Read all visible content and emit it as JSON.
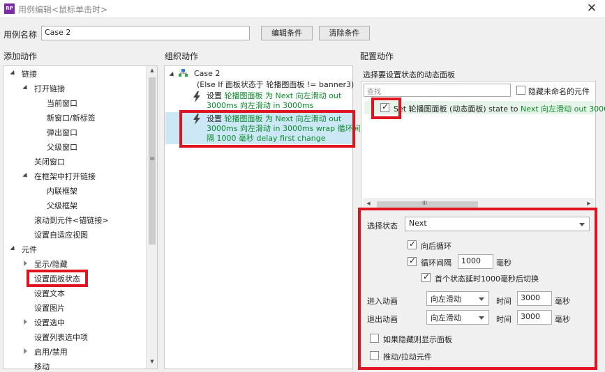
{
  "window": {
    "title": "用例编辑<鼠标单击时>",
    "app_icon": "RP",
    "close": "✕"
  },
  "case_name": {
    "label": "用例名称",
    "value": "Case 2",
    "edit_button": "编辑条件",
    "clear_button": "清除条件"
  },
  "add_actions": {
    "header": "添加动作",
    "items": [
      {
        "label": "链接",
        "kind": "open"
      },
      {
        "label": "打开链接",
        "kind": "open"
      },
      {
        "label": "当前窗口",
        "kind": "leaf"
      },
      {
        "label": "新窗口/新标签",
        "kind": "leaf"
      },
      {
        "label": "弹出窗口",
        "kind": "leaf"
      },
      {
        "label": "父级窗口",
        "kind": "leaf"
      },
      {
        "label": "关闭窗口",
        "kind": "leaf"
      },
      {
        "label": "在框架中打开链接",
        "kind": "open"
      },
      {
        "label": "内联框架",
        "kind": "leaf"
      },
      {
        "label": "父级框架",
        "kind": "leaf"
      },
      {
        "label": "滚动到元件<锚链接>",
        "kind": "leaf"
      },
      {
        "label": "设置自适应视图",
        "kind": "leaf"
      },
      {
        "label": "元件",
        "kind": "open"
      },
      {
        "label": "显示/隐藏",
        "kind": "closed"
      },
      {
        "label": "设置面板状态",
        "kind": "leaf"
      },
      {
        "label": "设置文本",
        "kind": "leaf"
      },
      {
        "label": "设置图片",
        "kind": "leaf"
      },
      {
        "label": "设置选中",
        "kind": "closed"
      },
      {
        "label": "设置列表选中项",
        "kind": "leaf"
      },
      {
        "label": "启用/禁用",
        "kind": "closed"
      },
      {
        "label": "移动",
        "kind": "leaf"
      }
    ],
    "scroll_mark": "≡"
  },
  "organize": {
    "header": "组织动作",
    "case_title": "Case 2",
    "condition": "(Else If 面板状态于 轮播图面板 != banner3)",
    "action1": {
      "prefix": "设置 ",
      "lines": [
        "轮播图面板 为 Next 向左滑动 out",
        "3000ms 向左滑动 in 3000ms"
      ]
    },
    "action2": {
      "prefix": "设置 ",
      "lines": [
        "轮播图面板 为 Next 向左滑动 out",
        "3000ms 向左滑动 in 3000ms wrap 循环间",
        "隔 1000 毫秒 delay first change"
      ]
    }
  },
  "configure": {
    "header": "配置动作",
    "subheader": "选择要设置状态的动态面板",
    "search_placeholder": "查找",
    "hide_unnamed": "隐藏未命名的元件",
    "row_prefix": "Set 轮播图面板 (动态面板) state to ",
    "row_green": "Next 向左滑动 out 3000",
    "hscroll_mark": "III",
    "select_state_label": "选择状态",
    "select_state_value": "Next",
    "wrap_label": "向后循环",
    "interval_label": "循环间隔",
    "interval_value": "1000",
    "interval_unit": "毫秒",
    "first_delay_label": "首个状态延时1000毫秒后切换",
    "enter_label": "进入动画",
    "enter_value": "向左滑动",
    "enter_time_label": "时间",
    "enter_time_value": "3000",
    "enter_time_unit": "毫秒",
    "exit_label": "退出动画",
    "exit_value": "向左滑动",
    "exit_time_label": "时间",
    "exit_time_value": "3000",
    "exit_time_unit": "毫秒",
    "show_if_hidden": "如果隐藏则显示面板",
    "push_pull": "推动/拉动元件"
  },
  "colors": {
    "highlight": "#e0141e",
    "action_text": "#0b8a2a",
    "selected_row": "#cce8f6"
  }
}
